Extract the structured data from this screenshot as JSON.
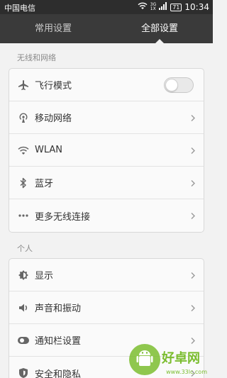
{
  "status_bar": {
    "carrier": "中国电信",
    "net_top": "3G",
    "net_bottom": "1X",
    "battery": "71",
    "time": "10:34"
  },
  "tabs": [
    {
      "label": "常用设置",
      "active": false
    },
    {
      "label": "全部设置",
      "active": true
    }
  ],
  "sections": [
    {
      "title": "无线和网络",
      "items": [
        {
          "label": "飞行模式",
          "icon": "airplane-icon",
          "control": "toggle",
          "toggle_on": false
        },
        {
          "label": "移动网络",
          "icon": "cellular-signal-icon",
          "control": "chevron"
        },
        {
          "label": "WLAN",
          "icon": "wifi-icon",
          "control": "chevron"
        },
        {
          "label": "蓝牙",
          "icon": "bluetooth-icon",
          "control": "chevron"
        },
        {
          "label": "更多无线连接",
          "icon": "more-dots-icon",
          "control": "chevron"
        }
      ]
    },
    {
      "title": "个人",
      "items": [
        {
          "label": "显示",
          "icon": "brightness-icon",
          "control": "chevron"
        },
        {
          "label": "声音和振动",
          "icon": "speaker-icon",
          "control": "chevron"
        },
        {
          "label": "通知栏设置",
          "icon": "toggle-outline-icon",
          "control": "chevron"
        },
        {
          "label": "安全和隐私",
          "icon": "shield-icon",
          "control": "chevron"
        }
      ]
    }
  ],
  "watermark": {
    "brand": "好卓网",
    "site": "www.33lc.com"
  },
  "colors": {
    "status_bar_bg": "#2d2d2d",
    "tab_bar_bg": "#3a3a3a",
    "page_bg": "#f2f2f2",
    "card_bg": "#fafafa",
    "watermark_green": "#7bbd2f"
  }
}
